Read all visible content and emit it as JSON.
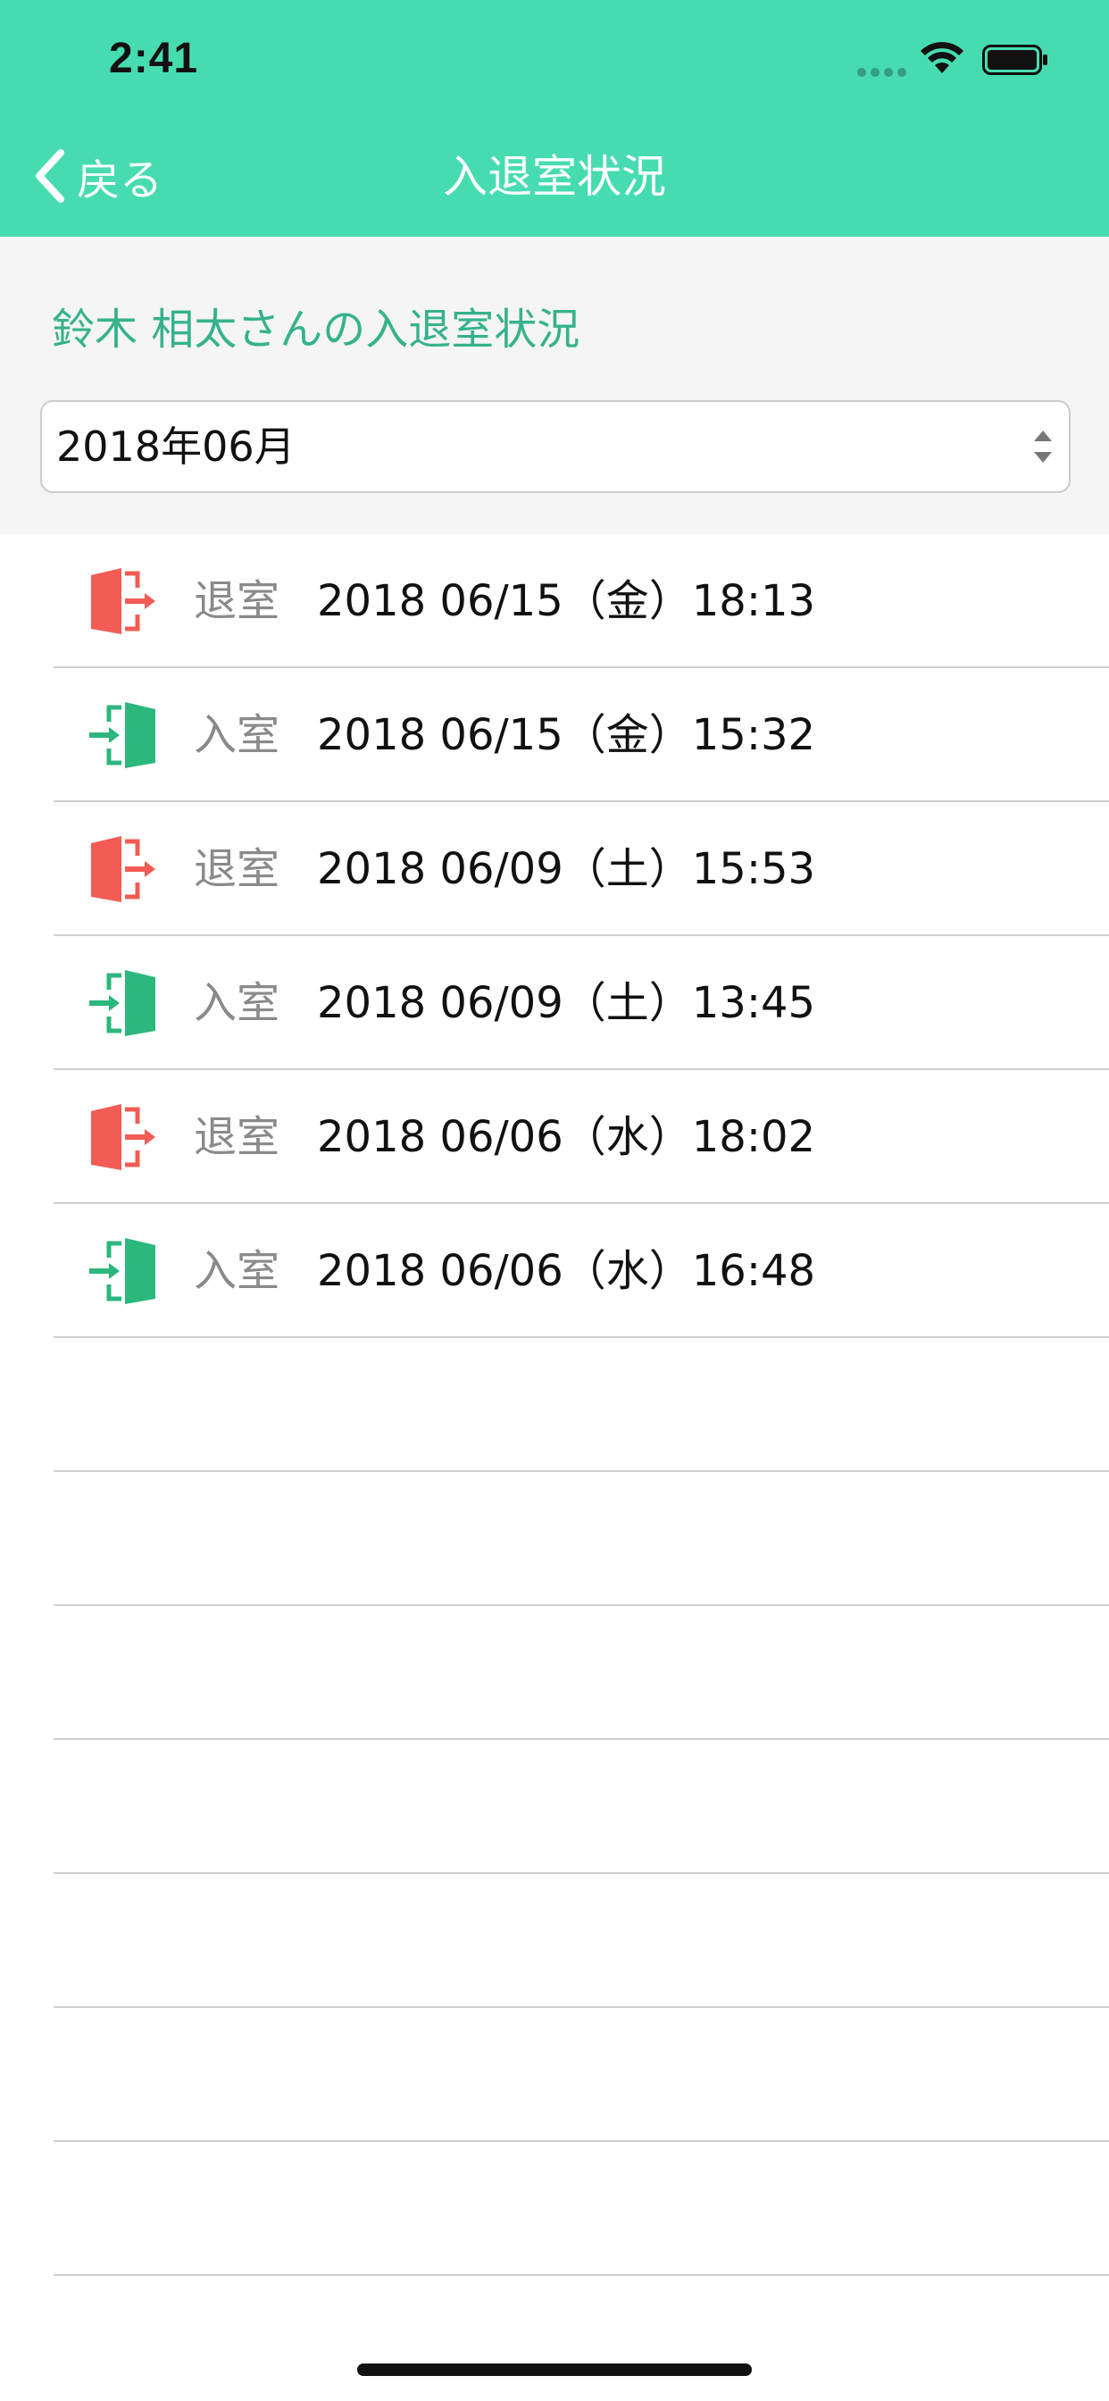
{
  "status_bar": {
    "time": "2:41",
    "signal_icon": "signal-dots-icon",
    "wifi_icon": "wifi-icon",
    "battery_icon": "battery-icon"
  },
  "nav": {
    "back_label": "戻る",
    "back_icon": "chevron-left-icon",
    "title": "入退室状況"
  },
  "filter": {
    "heading": "鈴木 相太さんの入退室状況",
    "month_value": "2018年06月",
    "select_icon": "select-arrows-icon"
  },
  "records": [
    {
      "type": "退室",
      "datetime": "2018 06/15（金）18:13",
      "icon": "exit-door-icon"
    },
    {
      "type": "入室",
      "datetime": "2018 06/15（金）15:32",
      "icon": "enter-door-icon"
    },
    {
      "type": "退室",
      "datetime": "2018 06/09（土）15:53",
      "icon": "exit-door-icon"
    },
    {
      "type": "入室",
      "datetime": "2018 06/09（土）13:45",
      "icon": "enter-door-icon"
    },
    {
      "type": "退室",
      "datetime": "2018 06/06（水）18:02",
      "icon": "exit-door-icon"
    },
    {
      "type": "入室",
      "datetime": "2018 06/06（水）16:48",
      "icon": "enter-door-icon"
    }
  ],
  "colors": {
    "header_bg": "#47dcb0",
    "accent_text": "#36b28c",
    "exit_icon": "#f25c54",
    "enter_icon": "#2cb77d",
    "filter_bg": "#f5f5f5"
  }
}
